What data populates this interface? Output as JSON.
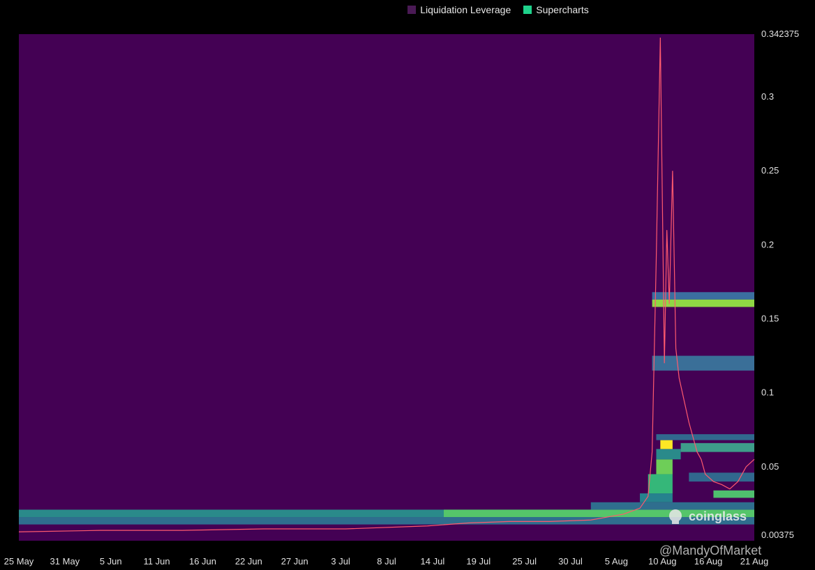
{
  "legend": [
    {
      "label": "Liquidation Leverage",
      "color": "#4a1a55"
    },
    {
      "label": "Supercharts",
      "color": "#1fd18b"
    }
  ],
  "watermark": "coinglass",
  "handle": "@MandyOfMarket",
  "chart_data": {
    "type": "heatmap",
    "title": "",
    "xlabel": "",
    "ylabel": "",
    "ylim": [
      0.0,
      0.342375
    ],
    "y_axis_position": "right",
    "y_ticks": [
      "0.342375",
      "0.3",
      "0.25",
      "0.2",
      "0.15",
      "0.1",
      "0.05",
      "0.00375"
    ],
    "y_tick_values": [
      0.342375,
      0.3,
      0.25,
      0.2,
      0.15,
      0.1,
      0.05,
      0.00375
    ],
    "x_ticks": [
      "25 May",
      "31 May",
      "5 Jun",
      "11 Jun",
      "16 Jun",
      "22 Jun",
      "27 Jun",
      "3 Jul",
      "8 Jul",
      "14 Jul",
      "19 Jul",
      "25 Jul",
      "30 Jul",
      "5 Aug",
      "10 Aug",
      "16 Aug",
      "21 Aug"
    ],
    "x_range_days": [
      0,
      90
    ],
    "background_color": "#440154",
    "bands": [
      {
        "x0": 0,
        "x1": 90,
        "y0": 0.011,
        "y1": 0.016,
        "color": "#2f6e8e"
      },
      {
        "x0": 0,
        "x1": 90,
        "y0": 0.016,
        "y1": 0.021,
        "color": "#2a8a8a"
      },
      {
        "x0": 52,
        "x1": 90,
        "y0": 0.016,
        "y1": 0.021,
        "color": "#55c56a"
      },
      {
        "x0": 70,
        "x1": 90,
        "y0": 0.021,
        "y1": 0.026,
        "color": "#2f6e8e"
      },
      {
        "x0": 76,
        "x1": 80,
        "y0": 0.026,
        "y1": 0.032,
        "color": "#26828e"
      },
      {
        "x0": 77,
        "x1": 80,
        "y0": 0.032,
        "y1": 0.045,
        "color": "#35b779"
      },
      {
        "x0": 78,
        "x1": 80,
        "y0": 0.045,
        "y1": 0.055,
        "color": "#6ece58"
      },
      {
        "x0": 78,
        "x1": 81,
        "y0": 0.055,
        "y1": 0.062,
        "color": "#2a8a8a"
      },
      {
        "x0": 78.5,
        "x1": 80,
        "y0": 0.062,
        "y1": 0.068,
        "color": "#fde725"
      },
      {
        "x0": 78,
        "x1": 90,
        "y0": 0.068,
        "y1": 0.072,
        "color": "#31688e"
      },
      {
        "x0": 81,
        "x1": 90,
        "y0": 0.06,
        "y1": 0.066,
        "color": "#3e9d8a"
      },
      {
        "x0": 82,
        "x1": 90,
        "y0": 0.04,
        "y1": 0.046,
        "color": "#31688e"
      },
      {
        "x0": 85,
        "x1": 90,
        "y0": 0.029,
        "y1": 0.034,
        "color": "#4fbf6e"
      },
      {
        "x0": 77.5,
        "x1": 90,
        "y0": 0.115,
        "y1": 0.125,
        "color": "#3a6f98"
      },
      {
        "x0": 77.5,
        "x1": 90,
        "y0": 0.163,
        "y1": 0.168,
        "color": "#3b6fa0"
      },
      {
        "x0": 77.5,
        "x1": 90,
        "y0": 0.158,
        "y1": 0.163,
        "color": "#8fd744"
      }
    ],
    "series": [
      {
        "type": "line",
        "color": "#ff5a6e",
        "x": [
          0,
          10,
          20,
          30,
          40,
          50,
          55,
          60,
          65,
          70,
          74,
          76,
          77,
          77.5,
          78,
          78.5,
          79,
          79.3,
          79.6,
          80,
          80.4,
          80.8,
          81.2,
          81.6,
          82,
          82.5,
          83,
          83.5,
          84,
          85,
          86,
          87,
          88,
          89,
          90
        ],
        "y": [
          0.006,
          0.007,
          0.007,
          0.008,
          0.008,
          0.01,
          0.012,
          0.013,
          0.013,
          0.014,
          0.018,
          0.022,
          0.03,
          0.06,
          0.19,
          0.34,
          0.12,
          0.21,
          0.16,
          0.25,
          0.13,
          0.11,
          0.1,
          0.09,
          0.08,
          0.07,
          0.06,
          0.055,
          0.045,
          0.04,
          0.038,
          0.035,
          0.04,
          0.05,
          0.055
        ]
      }
    ]
  }
}
